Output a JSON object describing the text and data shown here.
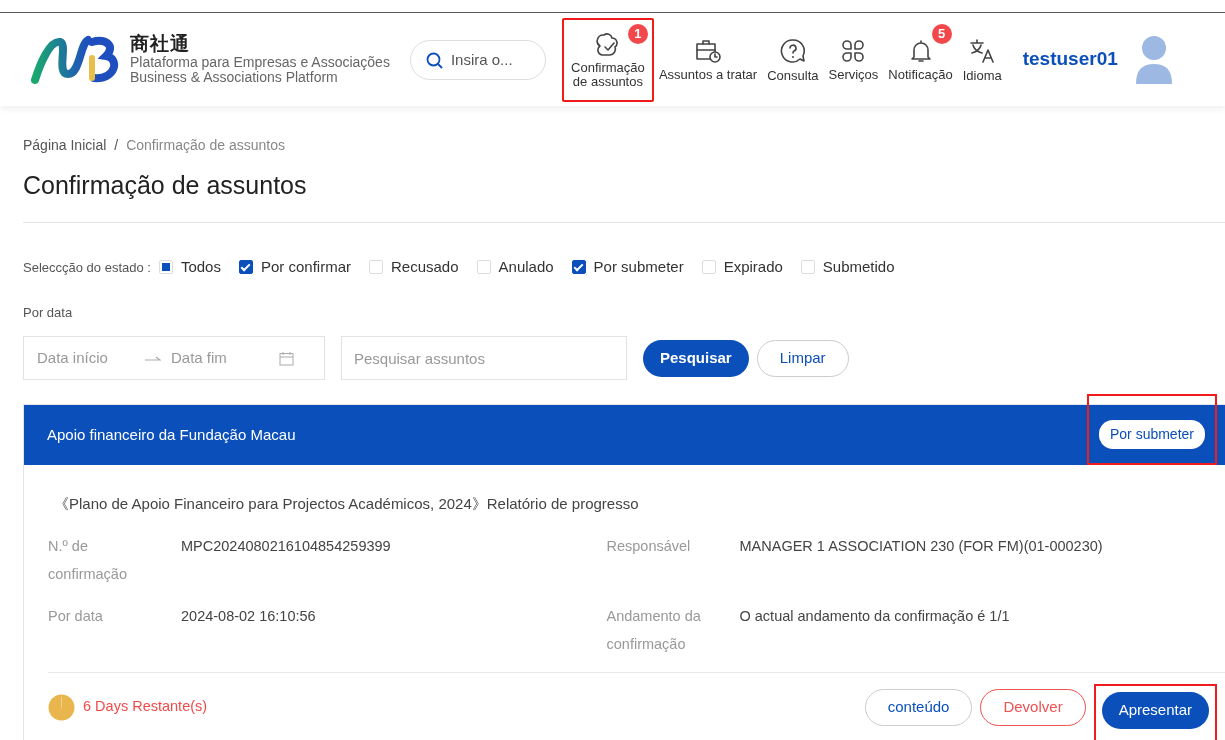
{
  "header": {
    "brand": "商社通",
    "subtitle_pt": "Plataforma para Empresas e Associações",
    "subtitle_en": "Business & Associations Platform",
    "search": {
      "placeholder": "Insira o..."
    },
    "nav": [
      {
        "kind": "confirm",
        "label": "Confirmação de assuntos",
        "badge": "1",
        "highlighted": true
      },
      {
        "kind": "tasks",
        "label": "Assuntos a tratar",
        "highlighted": false
      },
      {
        "kind": "help",
        "label": "Consulta",
        "highlighted": false
      },
      {
        "kind": "services",
        "label": "Serviços",
        "highlighted": false
      },
      {
        "kind": "bell",
        "label": "Notificação",
        "badge": "5",
        "highlighted": false
      },
      {
        "kind": "lang",
        "label": "Idioma",
        "highlighted": false
      }
    ],
    "user": "testuser01"
  },
  "breadcrumb_separator": "/",
  "breadcrumb": [
    {
      "label": "Página Inicial",
      "selected": false
    },
    {
      "label": "Confirmação de assuntos",
      "selected": true
    }
  ],
  "page_title": "Confirmação de assuntos",
  "filters": {
    "label": "Seleccção do estado :",
    "statuses": [
      {
        "label": "Todos",
        "checked": false,
        "indeterminate": true
      },
      {
        "label": "Por confirmar",
        "checked": true
      },
      {
        "label": "Recusado",
        "checked": false
      },
      {
        "label": "Anulado",
        "checked": false
      },
      {
        "label": "Por submeter",
        "checked": true
      },
      {
        "label": "Expirado",
        "checked": false
      },
      {
        "label": "Submetido",
        "checked": false
      }
    ],
    "date_label": "Por data",
    "date_start": {
      "placeholder": "Data início"
    },
    "date_end": {
      "placeholder": "Data fim"
    },
    "search": {
      "placeholder": "Pesquisar assuntos"
    },
    "search_button": "Pesquisar",
    "clear_button": "Limpar"
  },
  "card": {
    "title": "Apoio financeiro da Fundação Macau",
    "status": "Por submeter",
    "status_highlighted": true,
    "subject": "《Plano de Apoio Financeiro para Projectos Académicos, 2024》Relatório de progresso",
    "fields": [
      {
        "label": "N.º de confirmação",
        "value": "MPC2024080216104854259399"
      },
      {
        "label": "Responsável",
        "value": "MANAGER 1 ASSOCIATION 230 (FOR FM)(01-000230)"
      },
      {
        "label": "Por data",
        "value": "2024-08-02 16:10:56"
      },
      {
        "label": "Andamento da confirmação",
        "value": "O actual andamento da confirmação é 1/1"
      }
    ],
    "remaining": "6 Days Restante(s)",
    "actions": [
      {
        "kind": "outline",
        "label": "conteúdo",
        "highlighted": false
      },
      {
        "kind": "danger",
        "label": "Devolver",
        "highlighted": false
      },
      {
        "kind": "primary",
        "label": "Apresentar",
        "highlighted": true
      }
    ]
  }
}
